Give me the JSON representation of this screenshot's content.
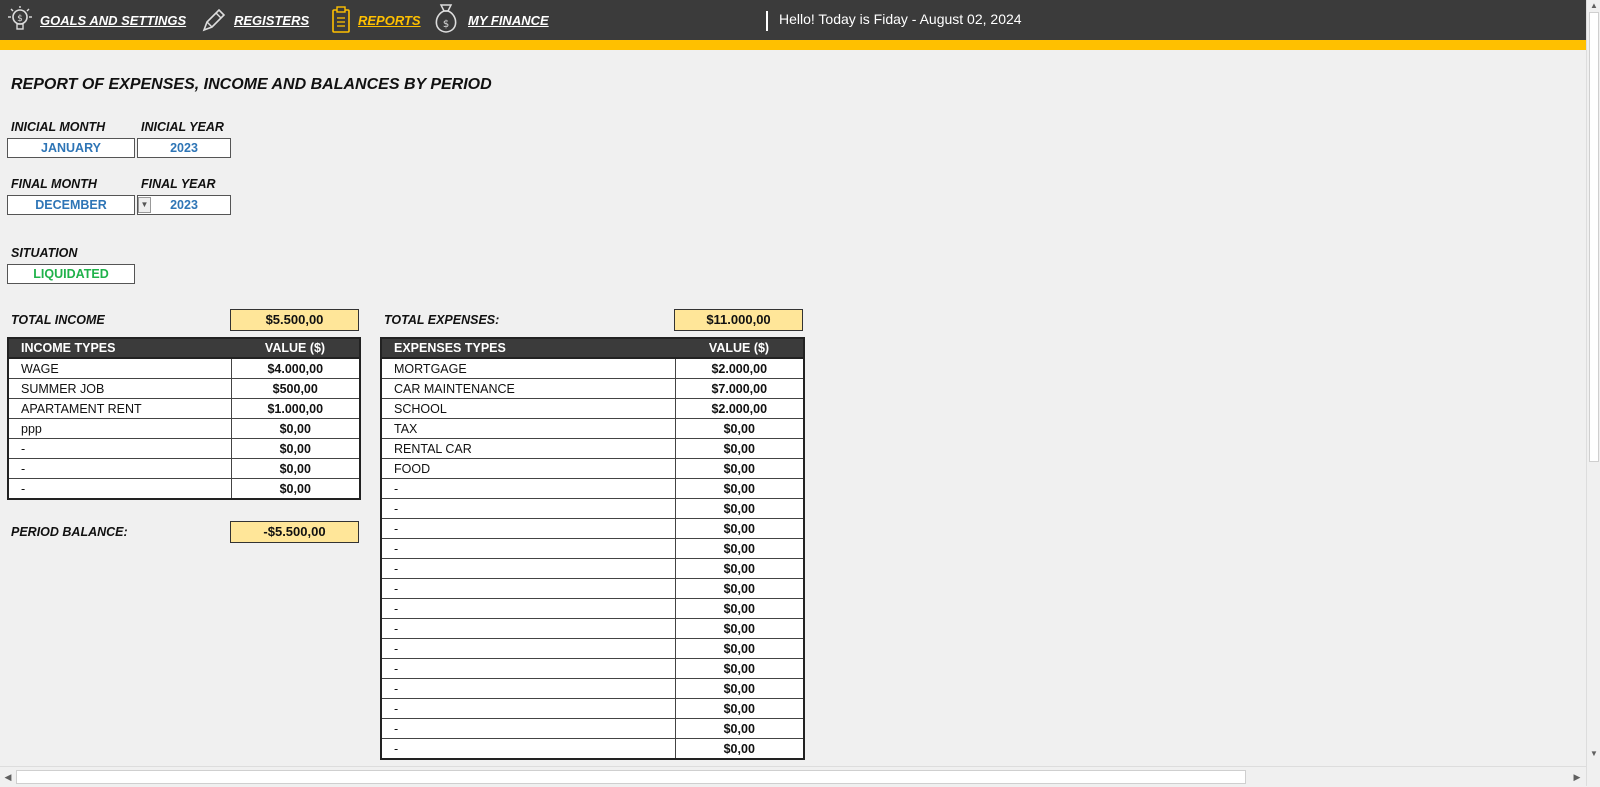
{
  "nav": {
    "items": [
      {
        "label": "GOALS AND SETTINGS",
        "icon": "lightbulb-dollar-icon"
      },
      {
        "label": "REGISTERS",
        "icon": "pencil-icon"
      },
      {
        "label": "REPORTS",
        "icon": "clipboard-icon",
        "active": true
      },
      {
        "label": "MY FINANCE",
        "icon": "money-bag-icon"
      }
    ],
    "greeting": "Hello! Today is Fiday - August 02, 2024"
  },
  "colors": {
    "topbar": "#3b3b3b",
    "accent": "#ffc000",
    "total_fill": "#ffe699",
    "field_blue": "#2e75b6",
    "status_green": "#1fb24a"
  },
  "report": {
    "title": "REPORT OF EXPENSES, INCOME AND BALANCES BY PERIOD",
    "initial_month_label": "INICIAL MONTH",
    "initial_month": "JANUARY",
    "initial_year_label": "INICIAL YEAR",
    "initial_year": "2023",
    "final_month_label": "FINAL MONTH",
    "final_month": "DECEMBER",
    "final_year_label": "FINAL YEAR",
    "final_year": "2023",
    "situation_label": "SITUATION",
    "situation": "LIQUIDATED"
  },
  "income": {
    "total_label": "TOTAL INCOME",
    "total": "$5.500,00",
    "col_type": "INCOME TYPES",
    "col_value": "VALUE ($)",
    "rows": [
      {
        "type": "WAGE",
        "value": "$4.000,00"
      },
      {
        "type": "SUMMER JOB",
        "value": "$500,00"
      },
      {
        "type": "APARTAMENT RENT",
        "value": "$1.000,00"
      },
      {
        "type": "ppp",
        "value": "$0,00"
      },
      {
        "type": "-",
        "value": "$0,00"
      },
      {
        "type": "-",
        "value": "$0,00"
      },
      {
        "type": "-",
        "value": "$0,00"
      }
    ],
    "balance_label": "PERIOD BALANCE:",
    "balance": "-$5.500,00"
  },
  "expenses": {
    "total_label": "TOTAL EXPENSES:",
    "total": "$11.000,00",
    "col_type": "EXPENSES TYPES",
    "col_value": "VALUE ($)",
    "rows": [
      {
        "type": "MORTGAGE",
        "value": "$2.000,00"
      },
      {
        "type": "CAR MAINTENANCE",
        "value": "$7.000,00"
      },
      {
        "type": "SCHOOL",
        "value": "$2.000,00"
      },
      {
        "type": "TAX",
        "value": "$0,00"
      },
      {
        "type": "RENTAL CAR",
        "value": "$0,00"
      },
      {
        "type": "FOOD",
        "value": "$0,00"
      },
      {
        "type": "-",
        "value": "$0,00"
      },
      {
        "type": "-",
        "value": "$0,00"
      },
      {
        "type": "-",
        "value": "$0,00"
      },
      {
        "type": "-",
        "value": "$0,00"
      },
      {
        "type": "-",
        "value": "$0,00"
      },
      {
        "type": "-",
        "value": "$0,00"
      },
      {
        "type": "-",
        "value": "$0,00"
      },
      {
        "type": "-",
        "value": "$0,00"
      },
      {
        "type": "-",
        "value": "$0,00"
      },
      {
        "type": "-",
        "value": "$0,00"
      },
      {
        "type": "-",
        "value": "$0,00"
      },
      {
        "type": "-",
        "value": "$0,00"
      },
      {
        "type": "-",
        "value": "$0,00"
      },
      {
        "type": "-",
        "value": "$0,00"
      }
    ]
  }
}
